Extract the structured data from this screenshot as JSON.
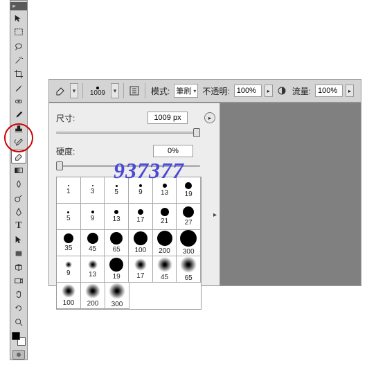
{
  "toolbar": {
    "tools": [
      "move",
      "marquee",
      "lasso",
      "wand",
      "crop",
      "eyedropper",
      "healing",
      "brush",
      "stamp",
      "history-brush",
      "eraser",
      "gradient",
      "blur",
      "dodge",
      "pen",
      "type",
      "path-select",
      "rectangle",
      "hand",
      "zoom",
      "rotate-view",
      "3d-rotate",
      "3d-orbit"
    ],
    "selected_index": 10
  },
  "options_bar": {
    "brush_size_number": "1009",
    "mode_label": "模式:",
    "mode_value": "筆刷",
    "opacity_label": "不透明:",
    "opacity_value": "100%",
    "flow_label": "流量:",
    "flow_value": "100%"
  },
  "brush_panel": {
    "size_label": "尺寸:",
    "size_value": "1009 px",
    "hardness_label": "硬度:",
    "hardness_value": "0%",
    "size_slider_percent": 100,
    "hardness_slider_percent": 0,
    "presets": [
      {
        "type": "hard",
        "diam": 2,
        "label": "1"
      },
      {
        "type": "hard",
        "diam": 2,
        "label": "3"
      },
      {
        "type": "hard",
        "diam": 3,
        "label": "5"
      },
      {
        "type": "hard",
        "diam": 4,
        "label": "9"
      },
      {
        "type": "hard",
        "diam": 6,
        "label": "13"
      },
      {
        "type": "hard",
        "diam": 10,
        "label": "19"
      },
      {
        "type": "hard",
        "diam": 3,
        "label": "5"
      },
      {
        "type": "hard",
        "diam": 4,
        "label": "9"
      },
      {
        "type": "hard",
        "diam": 6,
        "label": "13"
      },
      {
        "type": "hard",
        "diam": 8,
        "label": "17"
      },
      {
        "type": "hard",
        "diam": 12,
        "label": "21"
      },
      {
        "type": "hard",
        "diam": 16,
        "label": "27"
      },
      {
        "type": "hard",
        "diam": 14,
        "label": "35"
      },
      {
        "type": "hard",
        "diam": 16,
        "label": "45"
      },
      {
        "type": "hard",
        "diam": 18,
        "label": "65"
      },
      {
        "type": "hard",
        "diam": 20,
        "label": "100"
      },
      {
        "type": "hard",
        "diam": 22,
        "label": "200"
      },
      {
        "type": "hard",
        "diam": 24,
        "label": "300"
      },
      {
        "type": "soft",
        "diam": 10,
        "label": "9"
      },
      {
        "type": "soft",
        "diam": 14,
        "label": "13"
      },
      {
        "type": "hard",
        "diam": 20,
        "label": "19"
      },
      {
        "type": "soft",
        "diam": 18,
        "label": "17"
      },
      {
        "type": "soft",
        "diam": 22,
        "label": "45"
      },
      {
        "type": "soft",
        "diam": 24,
        "label": "65"
      },
      {
        "type": "soft",
        "diam": 20,
        "label": "100"
      },
      {
        "type": "soft",
        "diam": 22,
        "label": "200"
      },
      {
        "type": "soft",
        "diam": 24,
        "label": "300"
      }
    ]
  },
  "watermark": "937377"
}
